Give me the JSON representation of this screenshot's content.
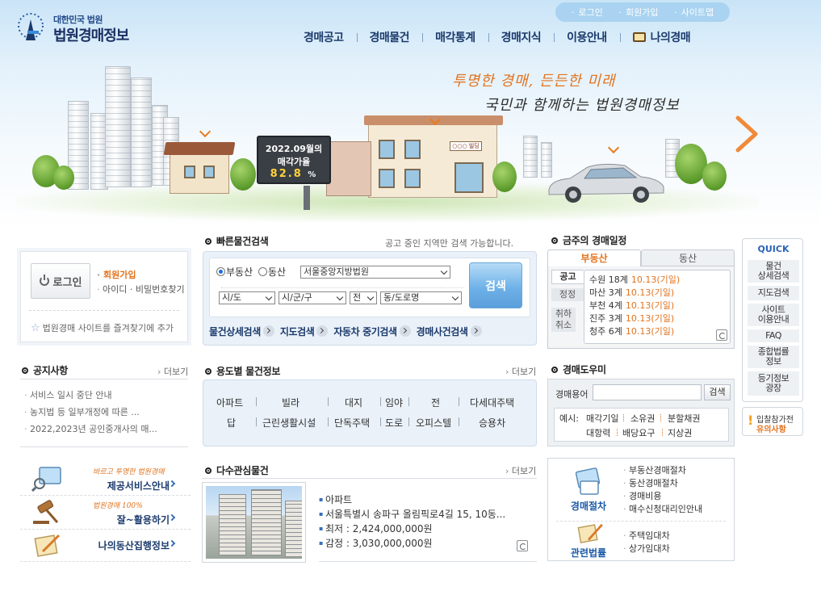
{
  "brand": {
    "small": "대한민국 법원",
    "big": "법원경매정보"
  },
  "topbar": [
    "로그인",
    "회원가입",
    "사이트맵"
  ],
  "gnb": [
    "경매공고",
    "경매물건",
    "매각통계",
    "경매지식",
    "이용안내",
    "나의경매"
  ],
  "hero": {
    "slogan1": "투명한 경매, 든든한 미래",
    "slogan2": "국민과 함께하는 법원경매정보",
    "billboard_line1": "2022.09월의",
    "billboard_line2": "매각가율",
    "billboard_value": "82.8",
    "billboard_unit": "%",
    "shop_sign": "○○○ 빌딩"
  },
  "login": {
    "button": "로그인",
    "join": "회원가입",
    "find": "아이디 · 비밀번호찾기",
    "favorite": "법원경매 사이트를 즐겨찾기에 추가"
  },
  "notice": {
    "title": "공지사항",
    "more": "더보기",
    "items": [
      "서비스 일시 중단 안내",
      "농지법 등 일부개정에 따른 ...",
      "2022,2023년 공인중개사의 매..."
    ]
  },
  "left_banners": [
    {
      "sub": "바르고 투명한 법원경매",
      "main": "제공서비스안내"
    },
    {
      "sub": "법원경매 100%",
      "main": "잘~활용하기"
    },
    {
      "sub": "",
      "main": "나의동산집행정보"
    }
  ],
  "quick_search": {
    "title": "빠른물건검색",
    "note": "공고 중인 지역만 검색 가능합니다.",
    "radio_realestate": "부동산",
    "radio_movable": "동산",
    "court": "서울중앙지방법원",
    "sido": "시/도",
    "sigungu": "시/군/구",
    "scope": "전",
    "dong": "동/도로명",
    "search_button": "검색",
    "links": [
      "물건상세검색",
      "지도검색",
      "자동차 중기검색",
      "경매사건검색"
    ]
  },
  "usage": {
    "title": "용도별 물건정보",
    "more": "더보기",
    "row1": [
      "아파트",
      "빌라",
      "대지",
      "임야",
      "전",
      "다세대주택"
    ],
    "row2": [
      "답",
      "근린생활시설",
      "단독주택",
      "도로",
      "오피스텔",
      "승용차"
    ]
  },
  "popular": {
    "title": "다수관심물건",
    "more": "더보기",
    "items": [
      "아파트",
      "서울특별시 송파구 올림픽로4길 15, 10동...",
      "최저 : 2,424,000,000원",
      "감정 : 3,030,000,000원"
    ]
  },
  "schedule": {
    "title": "금주의 경매일정",
    "tab_active": "부동산",
    "tab_other": "동산",
    "subtabs": [
      "공고",
      "정정",
      "취하취소"
    ],
    "items": [
      {
        "court": "수원 18계",
        "date": "10.13(기일)"
      },
      {
        "court": "마산 3계",
        "date": "10.13(기일)"
      },
      {
        "court": "부천 4계",
        "date": "10.13(기일)"
      },
      {
        "court": "진주 3계",
        "date": "10.13(기일)"
      },
      {
        "court": "청주 6계",
        "date": "10.13(기일)"
      }
    ]
  },
  "helper": {
    "title": "경매도우미",
    "label": "경매용어",
    "input_value": "",
    "button": "검색",
    "example_label": "예시:",
    "row1": [
      "매각기일",
      "소유권",
      "분할채권"
    ],
    "row2": [
      "대항력",
      "배당요구",
      "지상권"
    ]
  },
  "procedure": {
    "group1": {
      "title": "경매절차",
      "items": [
        "부동산경매절차",
        "동산경매절차",
        "경매비용",
        "매수신청대리인안내"
      ]
    },
    "group2": {
      "title": "관련법률",
      "items": [
        "주택임대차",
        "상가임대차"
      ]
    }
  },
  "quick_menu": {
    "title": "QUICK",
    "items": [
      "물건\n상세검색",
      "지도검색",
      "사이트\n이용안내",
      "FAQ",
      "종합법률\n정보",
      "등기정보\n광장"
    ],
    "bid_line1": "입찰참가전",
    "bid_line2": "유의사항"
  },
  "colors": {
    "navy": "#1b3a6b",
    "accent_orange": "#e2731e",
    "blue": "#3a6fb8",
    "panel_bg": "#eaf1f9"
  }
}
